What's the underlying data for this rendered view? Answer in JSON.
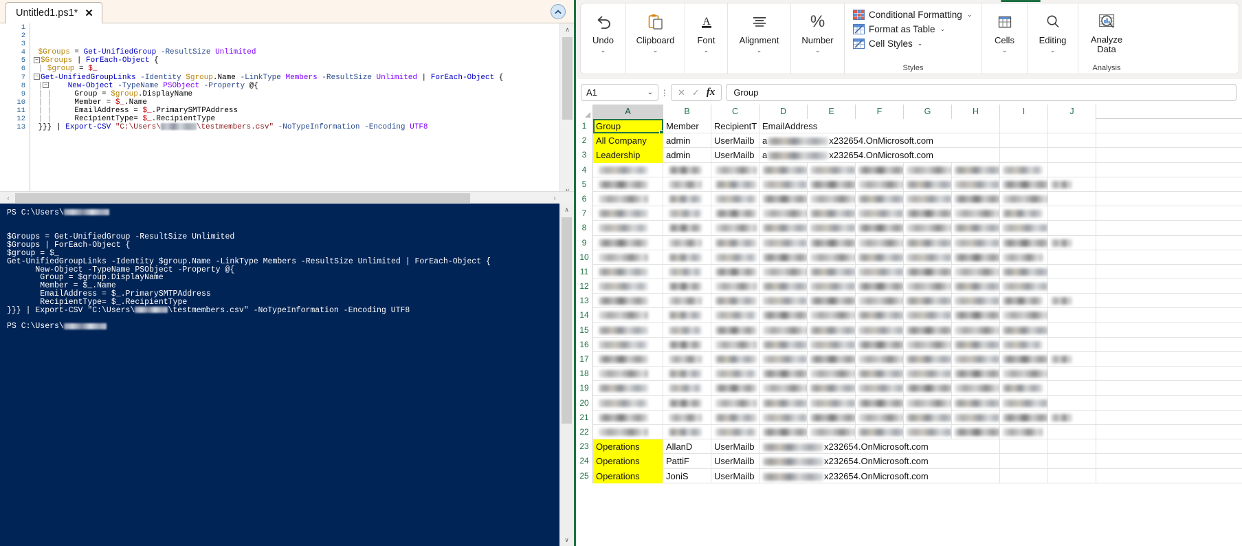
{
  "ise": {
    "tab_label": "Untitled1.ps1*",
    "tab_close": "✕",
    "collapse_icon": "▲",
    "editor": {
      "line_numbers": [
        "1",
        "2",
        "3",
        "4",
        "5",
        "6",
        "7",
        "8",
        "9",
        "10",
        "11",
        "12",
        "13"
      ],
      "lines": [
        "",
        "",
        "",
        "$Groups = Get-UnifiedGroup -ResultSize Unlimited",
        "$Groups | ForEach-Object {",
        "$group = $_",
        "Get-UnifiedGroupLinks -Identity $group.Name -LinkType Members -ResultSize Unlimited | ForEach-Object {",
        "    New-Object -TypeName PSObject -Property @{",
        "      Group = $group.DisplayName",
        "      Member = $_.Name",
        "      EmailAddress = $_.PrimarySMTPAddress",
        "      RecipientType= $_.RecipientType",
        "}}} | Export-CSV \"C:\\Users\\[REDACTED]\\testmembers.csv\" -NoTypeInformation -Encoding UTF8"
      ]
    },
    "console": {
      "prompt_top": "PS C:\\Users\\",
      "prompt_bottom": "PS C:\\Users\\",
      "lines": [
        "$Groups = Get-UnifiedGroup -ResultSize Unlimited",
        "$Groups | ForEach-Object {",
        "$group = $_",
        "Get-UnifiedGroupLinks -Identity $group.Name -LinkType Members -ResultSize Unlimited | ForEach-Object {",
        "      New-Object -TypeName PSObject -Property @{",
        "       Group = $group.DisplayName",
        "       Member = $_.Name",
        "       EmailAddress = $_.PrimarySMTPAddress",
        "       RecipientType= $_.RecipientType",
        "}}} | Export-CSV \"C:\\Users\\[REDACTED]\\testmembers.csv\" -NoTypeInformation -Encoding UTF8"
      ]
    },
    "scroll": {
      "up_arrow": "∧",
      "down_arrow": "∨",
      "left_arrow": "‹",
      "right_arrow": "›"
    }
  },
  "excel": {
    "ribbon": {
      "groups": [
        {
          "label": "Undo",
          "icon": "undo-icon",
          "glyph": "↶",
          "caret": "⌄"
        },
        {
          "label": "Clipboard",
          "icon": "clipboard-icon",
          "glyph": "ὌB",
          "caret": "⌄"
        },
        {
          "label": "Font",
          "icon": "font-icon",
          "glyph": "A",
          "caret": "⌄"
        },
        {
          "label": "Alignment",
          "icon": "alignment-icon",
          "glyph": "≡",
          "caret": "⌄"
        },
        {
          "label": "Number",
          "icon": "percent-icon",
          "glyph": "%",
          "caret": "⌄"
        }
      ],
      "styles": {
        "title": "Styles",
        "items": [
          {
            "label": "Conditional Formatting",
            "icon": "conditional-formatting-icon",
            "caret": "⌄"
          },
          {
            "label": "Format as Table",
            "icon": "format-as-table-icon",
            "caret": "⌄"
          },
          {
            "label": "Cell Styles",
            "icon": "cell-styles-icon",
            "caret": "⌄"
          }
        ]
      },
      "cells": {
        "label": "Cells",
        "icon": "cells-icon",
        "caret": "⌄"
      },
      "editing": {
        "label": "Editing",
        "icon": "search-icon",
        "caret": "⌄"
      },
      "analysis": {
        "title": "Analysis",
        "label_line1": "Analyze",
        "label_line2": "Data",
        "icon": "analyze-data-icon"
      }
    },
    "formula_bar": {
      "name_box_value": "A1",
      "name_box_caret": "⌄",
      "cancel_icon": "✕",
      "enter_icon": "✓",
      "fx_label": "fx",
      "formula_value": "Group",
      "more_icon": "⋮"
    },
    "grid": {
      "columns": [
        "A",
        "B",
        "C",
        "D",
        "E",
        "F",
        "G",
        "H",
        "I",
        "J"
      ],
      "selected_column": "A",
      "row_numbers": [
        "1",
        "2",
        "3",
        "4",
        "5",
        "6",
        "7",
        "8",
        "9",
        "10",
        "11",
        "12",
        "13",
        "14",
        "15",
        "16",
        "17",
        "18",
        "19",
        "20",
        "21",
        "22",
        "23",
        "24",
        "25"
      ],
      "rows": [
        {
          "num": "1",
          "type": "text",
          "a": "Group",
          "b": "Member",
          "c": "RecipientT",
          "d": "EmailAddress",
          "a_highlight": true,
          "selected": true
        },
        {
          "num": "2",
          "type": "partial",
          "a": "All Company",
          "b": "admin",
          "c": "UserMailb",
          "d_prefix": "a",
          "d_suffix": "x232654.OnMicrosoft.com",
          "a_highlight": true
        },
        {
          "num": "3",
          "type": "partial",
          "a": "Leadership",
          "b": "admin",
          "c": "UserMailb",
          "d_prefix": "a",
          "d_suffix": "x232654.OnMicrosoft.com",
          "a_highlight": true
        },
        {
          "num": "4",
          "type": "blur"
        },
        {
          "num": "5",
          "type": "blur"
        },
        {
          "num": "6",
          "type": "blur"
        },
        {
          "num": "7",
          "type": "blur"
        },
        {
          "num": "8",
          "type": "blur"
        },
        {
          "num": "9",
          "type": "blur"
        },
        {
          "num": "10",
          "type": "blur"
        },
        {
          "num": "11",
          "type": "blur"
        },
        {
          "num": "12",
          "type": "blur"
        },
        {
          "num": "13",
          "type": "blur"
        },
        {
          "num": "14",
          "type": "blur"
        },
        {
          "num": "15",
          "type": "blur"
        },
        {
          "num": "16",
          "type": "blur"
        },
        {
          "num": "17",
          "type": "blur"
        },
        {
          "num": "18",
          "type": "blur"
        },
        {
          "num": "19",
          "type": "blur"
        },
        {
          "num": "20",
          "type": "blur"
        },
        {
          "num": "21",
          "type": "blur"
        },
        {
          "num": "22",
          "type": "blur"
        },
        {
          "num": "23",
          "type": "partial",
          "a": "Operations",
          "b": "AllanD",
          "c": "UserMailb",
          "d_prefix": "",
          "d_suffix": "x232654.OnMicrosoft.com",
          "a_highlight": true
        },
        {
          "num": "24",
          "type": "partial",
          "a": "Operations",
          "b": "PattiF",
          "c": "UserMailb",
          "d_prefix": "",
          "d_suffix": "x232654.OnMicrosoft.com",
          "a_highlight": true
        },
        {
          "num": "25",
          "type": "partial",
          "a": "Operations",
          "b": "JoniS",
          "c": "UserMailb",
          "d_prefix": "",
          "d_suffix": "x232654.OnMicrosoft.com",
          "a_highlight": true
        }
      ]
    }
  },
  "colors": {
    "excel_green": "#217346",
    "powershell_blue": "#012456",
    "highlight_yellow": "#ffff00",
    "ise_tab_bg": "#fdf5ec"
  }
}
